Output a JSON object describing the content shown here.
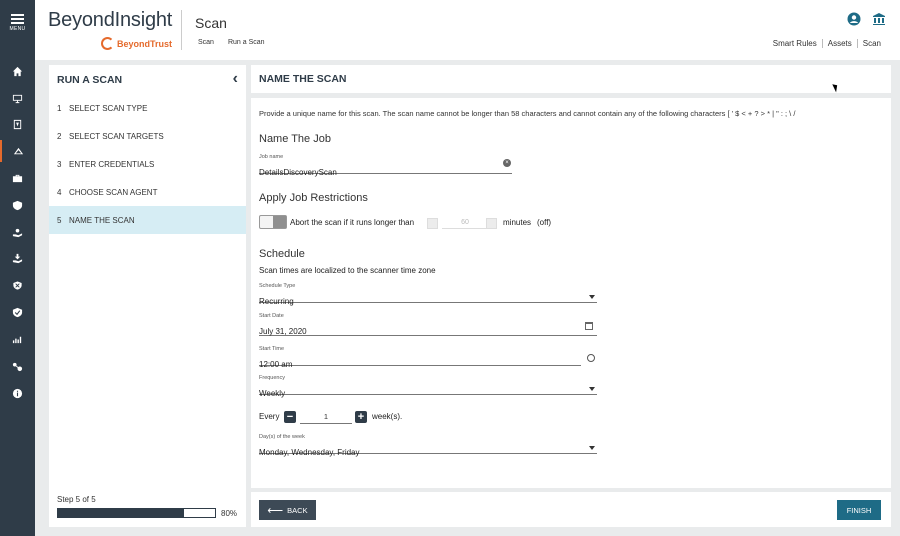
{
  "rail": {
    "menu_label": "MENU",
    "items": [
      "home-icon",
      "monitor-icon",
      "report-icon",
      "scan-icon",
      "briefcase-icon",
      "shield-icon",
      "hand-icon",
      "deploy-icon",
      "shield-x-icon",
      "shield-check-icon",
      "analytics-icon",
      "connections-icon",
      "info-icon"
    ],
    "active_index": 3,
    "accent_color": "#e56a2c"
  },
  "header": {
    "brand": "BeyondInsight",
    "sub_brand": "BeyondTrust",
    "page_title": "Scan",
    "breadcrumb": [
      "Scan",
      "Run a Scan"
    ],
    "links": [
      "Smart Rules",
      "Assets",
      "Scan"
    ],
    "icons": [
      "user-icon",
      "bank-icon"
    ]
  },
  "steps": {
    "title": "RUN A SCAN",
    "items": [
      {
        "num": "1",
        "label": "SELECT SCAN TYPE"
      },
      {
        "num": "2",
        "label": "SELECT SCAN TARGETS"
      },
      {
        "num": "3",
        "label": "ENTER CREDENTIALS"
      },
      {
        "num": "4",
        "label": "CHOOSE SCAN AGENT"
      },
      {
        "num": "5",
        "label": "NAME THE SCAN"
      }
    ],
    "active_index": 4,
    "progress_text": "Step 5 of 5",
    "progress_value": 0.8,
    "progress_label": "80%"
  },
  "main": {
    "title": "NAME THE SCAN",
    "intro": "Provide a unique name for this scan. The scan name cannot be longer than 58 characters and cannot contain any of the following characters [ ' $ < + ? > * | \" : ; \\ /",
    "name_job": {
      "heading": "Name The Job",
      "label": "Job name",
      "value": "DetailsDiscoveryScan"
    },
    "restrictions": {
      "heading": "Apply Job Restrictions",
      "abort_text": "Abort the scan if it runs longer than",
      "minutes_value": "60",
      "minutes_label": "minutes",
      "state": "(off)"
    },
    "schedule": {
      "heading": "Schedule",
      "note": "Scan times are localized to the scanner time zone",
      "type_label": "Schedule Type",
      "type_value": "Recurring",
      "start_date_label": "Start Date",
      "start_date_value": "July 31, 2020",
      "start_time_label": "Start Time",
      "start_time_value": "12:00 am",
      "frequency_label": "Frequency",
      "frequency_value": "Weekly",
      "every_label": "Every",
      "every_value": "1",
      "weeks_label": "week(s).",
      "days_label": "Day(s) of the week",
      "days_value": "Monday, Wednesday, Friday"
    }
  },
  "footer": {
    "back_label": "BACK",
    "finish_label": "FINISH",
    "finish_color": "#1e6b86"
  }
}
